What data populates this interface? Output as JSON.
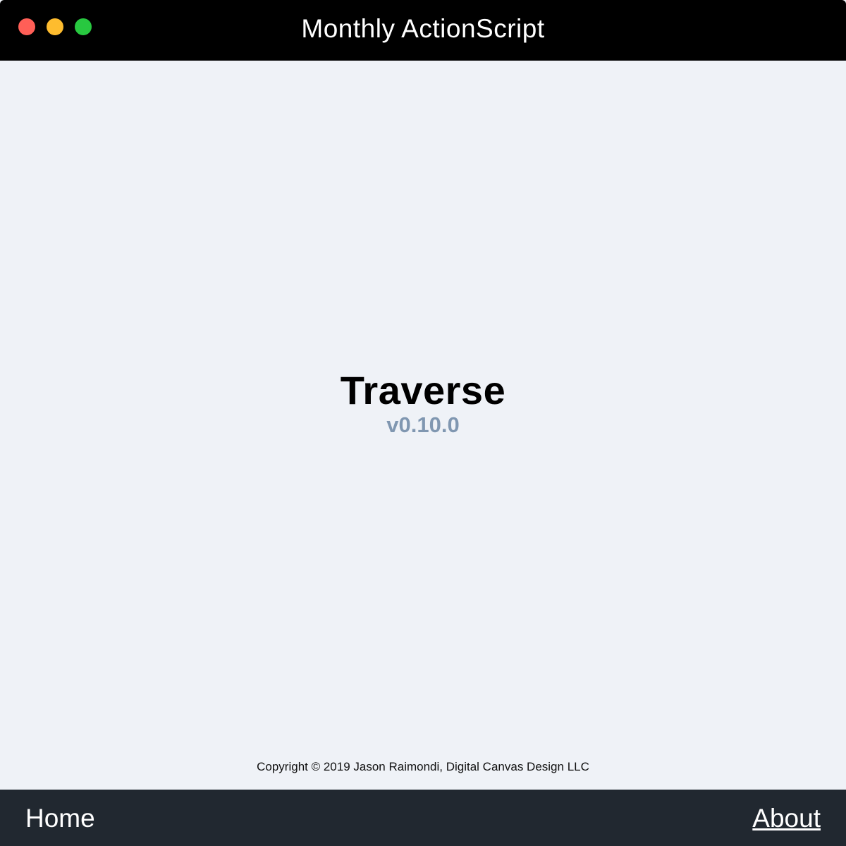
{
  "window": {
    "title": "Monthly ActionScript",
    "controls": {
      "close_color": "#ff5f57",
      "minimize_color": "#febc2e",
      "maximize_color": "#28c840"
    }
  },
  "main": {
    "app_name": "Traverse",
    "version": "v0.10.0",
    "copyright": "Copyright © 2019 Jason Raimondi, Digital Canvas Design LLC"
  },
  "footer": {
    "home_label": "Home",
    "about_label": "About"
  }
}
